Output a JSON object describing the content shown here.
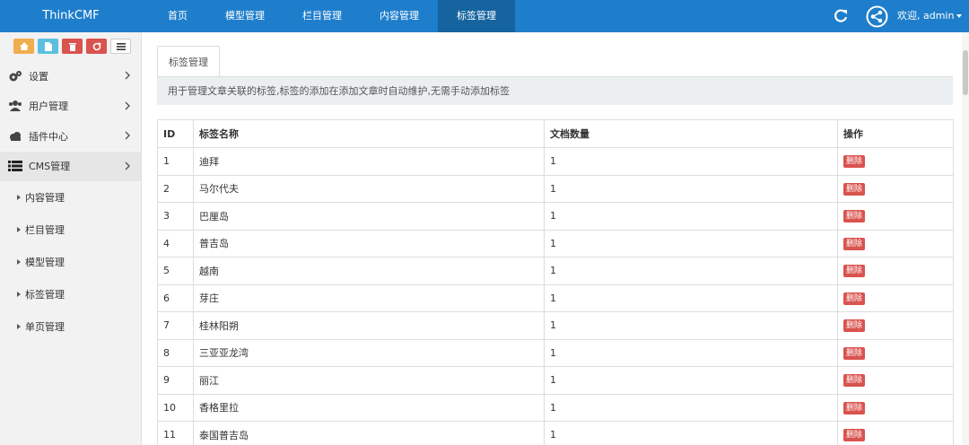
{
  "brand": "ThinkCMF",
  "nav": [
    {
      "label": "首页"
    },
    {
      "label": "模型管理"
    },
    {
      "label": "栏目管理"
    },
    {
      "label": "内容管理"
    },
    {
      "label": "标签管理"
    }
  ],
  "user": {
    "greeting": "欢迎, admin"
  },
  "sidebar": {
    "menu": [
      {
        "label": "设置",
        "icon": "gears-icon"
      },
      {
        "label": "用户管理",
        "icon": "users-icon"
      },
      {
        "label": "插件中心",
        "icon": "cloud-icon"
      },
      {
        "label": "CMS管理",
        "icon": "list-icon"
      }
    ],
    "submenu": [
      {
        "label": "内容管理"
      },
      {
        "label": "栏目管理"
      },
      {
        "label": "模型管理"
      },
      {
        "label": "标签管理"
      },
      {
        "label": "单页管理"
      }
    ]
  },
  "main": {
    "tab": "标签管理",
    "notice": "用于管理文章关联的标签,标签的添加在添加文章时自动维护,无需手动添加标签",
    "table": {
      "headers": [
        "ID",
        "标签名称",
        "文档数量",
        "操作"
      ],
      "delete_label": "删除",
      "rows": [
        {
          "id": "1",
          "name": "迪拜",
          "count": "1"
        },
        {
          "id": "2",
          "name": "马尔代夫",
          "count": "1"
        },
        {
          "id": "3",
          "name": "巴厘岛",
          "count": "1"
        },
        {
          "id": "4",
          "name": "普吉岛",
          "count": "1"
        },
        {
          "id": "5",
          "name": "越南",
          "count": "1"
        },
        {
          "id": "6",
          "name": "芽庄",
          "count": "1"
        },
        {
          "id": "7",
          "name": "桂林阳朔",
          "count": "1"
        },
        {
          "id": "8",
          "name": "三亚亚龙湾",
          "count": "1"
        },
        {
          "id": "9",
          "name": "丽江",
          "count": "1"
        },
        {
          "id": "10",
          "name": "香格里拉",
          "count": "1"
        },
        {
          "id": "11",
          "name": "泰国普吉岛",
          "count": "1"
        }
      ]
    }
  },
  "colors": {
    "topbar": "#1e7ecb",
    "active_nav": "#15649f",
    "delete": "#d9534f"
  }
}
